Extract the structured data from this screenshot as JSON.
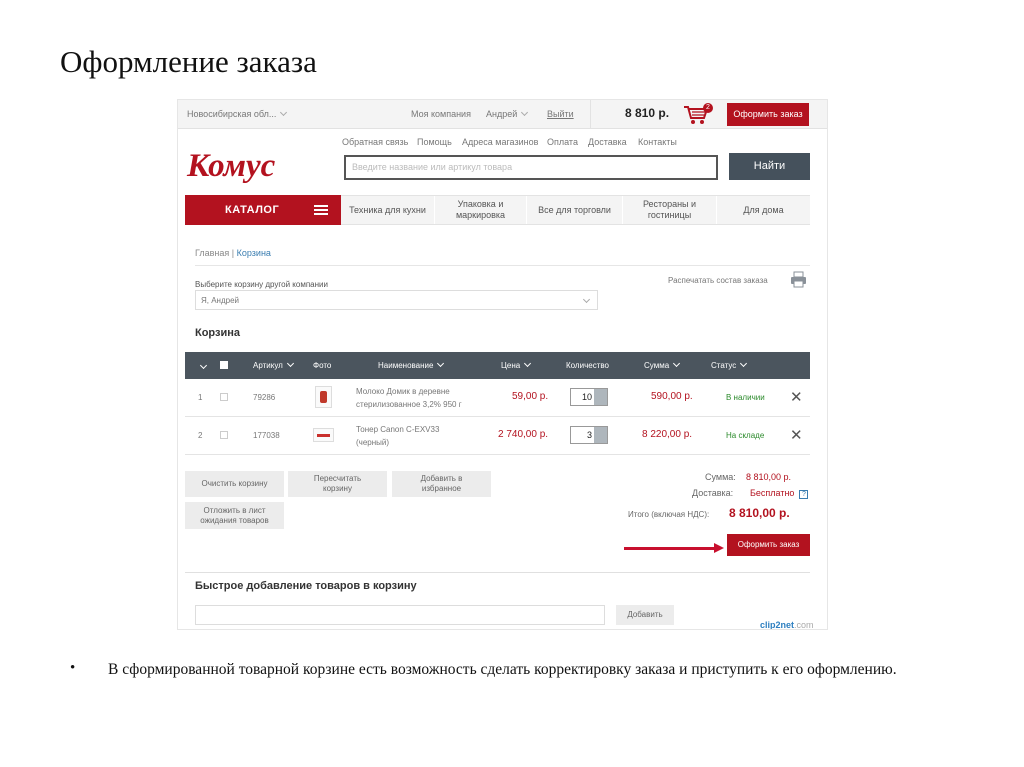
{
  "slide": {
    "title": "Оформление заказа",
    "bullet_mark": "•",
    "bullet_text": "В сформированной товарной корзине есть возможность сделать корректировку заказа и приступить к его оформлению."
  },
  "site": {
    "topbar": {
      "region": "Новосибирская обл...",
      "company": "Моя компания",
      "user": "Андрей",
      "logout": "Выйти",
      "cart_total": "8 810 р.",
      "cart_count": "2",
      "checkout_button": "Оформить заказ"
    },
    "logo_text": "Комус",
    "top_links": [
      "Обратная связь",
      "Помощь",
      "Адреса магазинов",
      "Оплата",
      "Доставка",
      "Контакты"
    ],
    "search": {
      "placeholder": "Введите название или артикул товара",
      "button": "Найти"
    },
    "catalog_button": "КАТАЛОГ",
    "nav": [
      "Техника для кухни",
      "Упаковка и маркировка",
      "Все для торговли",
      "Рестораны и гостиницы",
      "Для дома"
    ],
    "breadcrumb": {
      "home": "Главная",
      "separator": "|",
      "current": "Корзина"
    },
    "print_link": "Распечатать состав заказа",
    "choose_cart_label": "Выберите корзину другой компании",
    "choose_cart_value": "Я, Андрей",
    "cart_heading": "Корзина",
    "table_headers": {
      "article": "Артикул",
      "photo": "Фото",
      "name": "Наименование",
      "price": "Цена",
      "qty": "Количество",
      "sum": "Сумма",
      "status": "Статус"
    },
    "rows": [
      {
        "num": "1",
        "article": "79286",
        "name_line1": "Молоко Домик в деревне",
        "name_line2": "стерилизованное 3,2% 950 г",
        "price": "59,00 р.",
        "qty": "10",
        "sum": "590,00 р.",
        "status": "В наличии",
        "remove": "✕"
      },
      {
        "num": "2",
        "article": "177038",
        "name_line1": "Тонер Canon C-EXV33",
        "name_line2": "(черный)",
        "price": "2 740,00 р.",
        "qty": "3",
        "sum": "8 220,00 р.",
        "status": "На складе",
        "remove": "✕"
      }
    ],
    "actions": {
      "clear": "Очистить корзину",
      "recalc": "Пересчитать корзину",
      "favorites": "Добавить в избранное",
      "postpone": "Отложить в лист ожидания товаров"
    },
    "summary": {
      "sum_label": "Сумма:",
      "sum_value": "8 810,00 р.",
      "delivery_label": "Доставка:",
      "delivery_value": "Бесплатно",
      "help": "?",
      "total_label": "Итого (включая НДС):",
      "total_value": "8 810,00 р."
    },
    "checkout_button": "Оформить заказ",
    "quick_add": {
      "heading": "Быстрое добавление товаров в корзину",
      "button": "Добавить"
    },
    "watermark": {
      "brand": "clip2net",
      "suffix": ".com"
    }
  },
  "colors": {
    "brand_red": "#b3121f",
    "arrow_red": "#c8102e",
    "header_dark": "#4b555e",
    "in_stock_green": "#2b8a2b",
    "link_blue": "#3a7db0"
  }
}
